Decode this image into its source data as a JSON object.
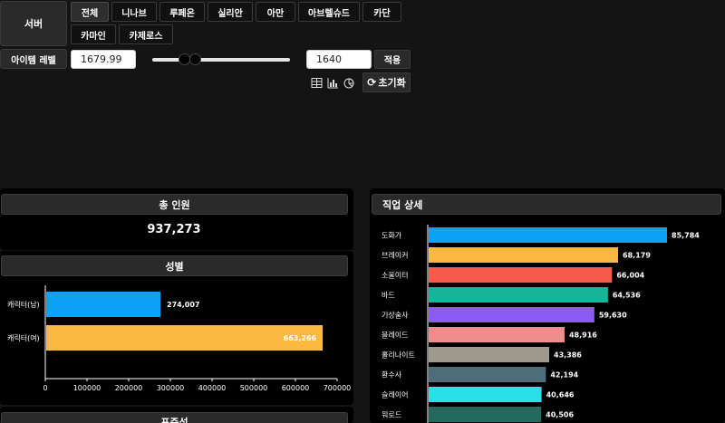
{
  "server": {
    "label": "서버",
    "options": [
      "전체",
      "니나브",
      "루페온",
      "실리안",
      "아만",
      "아브렐슈드",
      "카단",
      "카마인",
      "카제로스"
    ],
    "selected": "전체"
  },
  "item_level": {
    "label": "아이템 레벨",
    "max_value": "1679.99",
    "min_value": "1640",
    "apply_label": "적용",
    "reset_label": "초기화",
    "slider_low": 1640,
    "slider_high": 1679.99
  },
  "view_icons": [
    "table-icon",
    "bar-chart-icon",
    "pie-chart-icon"
  ],
  "total": {
    "title": "총 인원",
    "value": "937,273"
  },
  "gender": {
    "title": "성별"
  },
  "class_detail": {
    "title": "직업 상세"
  },
  "bottom_panel_title": "표준석",
  "chart_data": [
    {
      "type": "bar",
      "orientation": "horizontal",
      "categories": [
        "캐릭터(남)",
        "캐릭터(여)"
      ],
      "values": [
        274007,
        663266
      ],
      "value_labels": [
        "274,007",
        "663,266"
      ],
      "colors": [
        "#0da2f5",
        "#fcb940"
      ],
      "xlim": [
        0,
        700000
      ],
      "xticks": [
        0,
        100000,
        200000,
        300000,
        400000,
        500000,
        600000,
        700000
      ],
      "grid": false
    },
    {
      "type": "bar",
      "orientation": "horizontal",
      "categories": [
        "도화가",
        "브레이커",
        "소울이터",
        "바드",
        "기상술사",
        "블레이드",
        "홀리나이트",
        "환수사",
        "슬레이어",
        "워로드"
      ],
      "values": [
        85784,
        68179,
        66004,
        64536,
        59630,
        48916,
        43386,
        42194,
        40646,
        40506
      ],
      "value_labels": [
        "85,784",
        "68,179",
        "66,004",
        "64,536",
        "59,630",
        "48,916",
        "43,386",
        "42,194",
        "40,646",
        "40,506"
      ],
      "colors": [
        "#0da2f5",
        "#fcb940",
        "#f55a4a",
        "#16b59b",
        "#8a5cf5",
        "#ef8c8c",
        "#9d9a8c",
        "#4f6c7a",
        "#29e0e8",
        "#25695e"
      ],
      "grid": false
    }
  ]
}
